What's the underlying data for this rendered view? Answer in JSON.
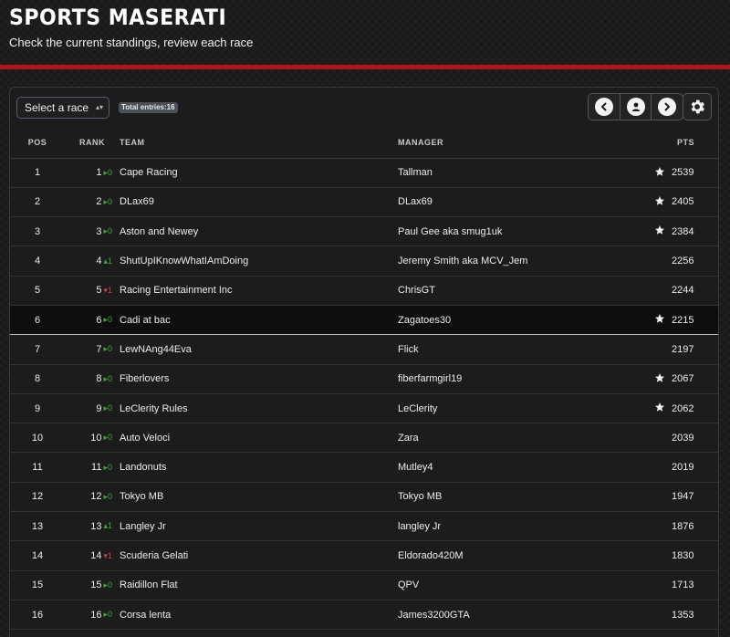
{
  "header": {
    "title": "SPORTS MASERATI",
    "subtitle": "Check the current standings, review each race"
  },
  "toolbar": {
    "race_select": {
      "value": "Select a race"
    },
    "total_entries_label": "Total entries:16"
  },
  "columns": {
    "pos": "POS",
    "rank": "RANK",
    "team": "TEAM",
    "manager": "MANAGER",
    "pts": "PTS"
  },
  "icons": {
    "prev": "chevron-left-icon",
    "profile": "user-icon",
    "next": "chevron-right-icon",
    "settings": "gear-icon",
    "favorite": "star-icon"
  },
  "colors": {
    "accent_red": "#b3121b",
    "up_green": "#3fa83f",
    "down_red": "#c9404a"
  },
  "rows": [
    {
      "pos": "1",
      "rank": "1",
      "change": "▸0",
      "dir": "same",
      "team": "Cape Racing",
      "manager": "Tallman",
      "star": true,
      "pts": "2539"
    },
    {
      "pos": "2",
      "rank": "2",
      "change": "▸0",
      "dir": "same",
      "team": "DLax69",
      "manager": "DLax69",
      "star": true,
      "pts": "2405"
    },
    {
      "pos": "3",
      "rank": "3",
      "change": "▸0",
      "dir": "same",
      "team": "Aston and Newey",
      "manager": "Paul Gee aka smug1uk",
      "star": true,
      "pts": "2384"
    },
    {
      "pos": "4",
      "rank": "4",
      "change": "▴1",
      "dir": "up",
      "team": "ShutUpIKnowWhatIAmDoing",
      "manager": "Jeremy Smith aka MCV_Jem",
      "star": false,
      "pts": "2256"
    },
    {
      "pos": "5",
      "rank": "5",
      "change": "▾1",
      "dir": "down",
      "team": "Racing Entertainment Inc",
      "manager": "ChrisGT",
      "star": false,
      "pts": "2244"
    },
    {
      "pos": "6",
      "rank": "6",
      "change": "▸0",
      "dir": "same",
      "team": "Cadi at bac",
      "manager": "Zagatoes30",
      "star": true,
      "pts": "2215",
      "highlight": true
    },
    {
      "pos": "7",
      "rank": "7",
      "change": "▸0",
      "dir": "same",
      "team": "LewNAng44Eva",
      "manager": "Flick",
      "star": false,
      "pts": "2197"
    },
    {
      "pos": "8",
      "rank": "8",
      "change": "▸0",
      "dir": "same",
      "team": "Fiberlovers",
      "manager": "fiberfarmgirl19",
      "star": true,
      "pts": "2067"
    },
    {
      "pos": "9",
      "rank": "9",
      "change": "▸0",
      "dir": "same",
      "team": "LeClerity Rules",
      "manager": "LeClerity",
      "star": true,
      "pts": "2062"
    },
    {
      "pos": "10",
      "rank": "10",
      "change": "▸0",
      "dir": "same",
      "team": "Auto Veloci",
      "manager": "Zara",
      "star": false,
      "pts": "2039"
    },
    {
      "pos": "11",
      "rank": "11",
      "change": "▸0",
      "dir": "same",
      "team": "Landonuts",
      "manager": "Mutley4",
      "star": false,
      "pts": "2019"
    },
    {
      "pos": "12",
      "rank": "12",
      "change": "▸0",
      "dir": "same",
      "team": "Tokyo MB",
      "manager": "Tokyo MB",
      "star": false,
      "pts": "1947"
    },
    {
      "pos": "13",
      "rank": "13",
      "change": "▴1",
      "dir": "up",
      "team": "Langley Jr",
      "manager": "langley Jr",
      "star": false,
      "pts": "1876"
    },
    {
      "pos": "14",
      "rank": "14",
      "change": "▾1",
      "dir": "down",
      "team": "Scuderia Gelati",
      "manager": "Eldorado420M",
      "star": false,
      "pts": "1830"
    },
    {
      "pos": "15",
      "rank": "15",
      "change": "▸0",
      "dir": "same",
      "team": "Raidillon Flat",
      "manager": "QPV",
      "star": false,
      "pts": "1713"
    },
    {
      "pos": "16",
      "rank": "16",
      "change": "▸0",
      "dir": "same",
      "team": "Corsa lenta",
      "manager": "James3200GTA",
      "star": false,
      "pts": "1353"
    }
  ]
}
